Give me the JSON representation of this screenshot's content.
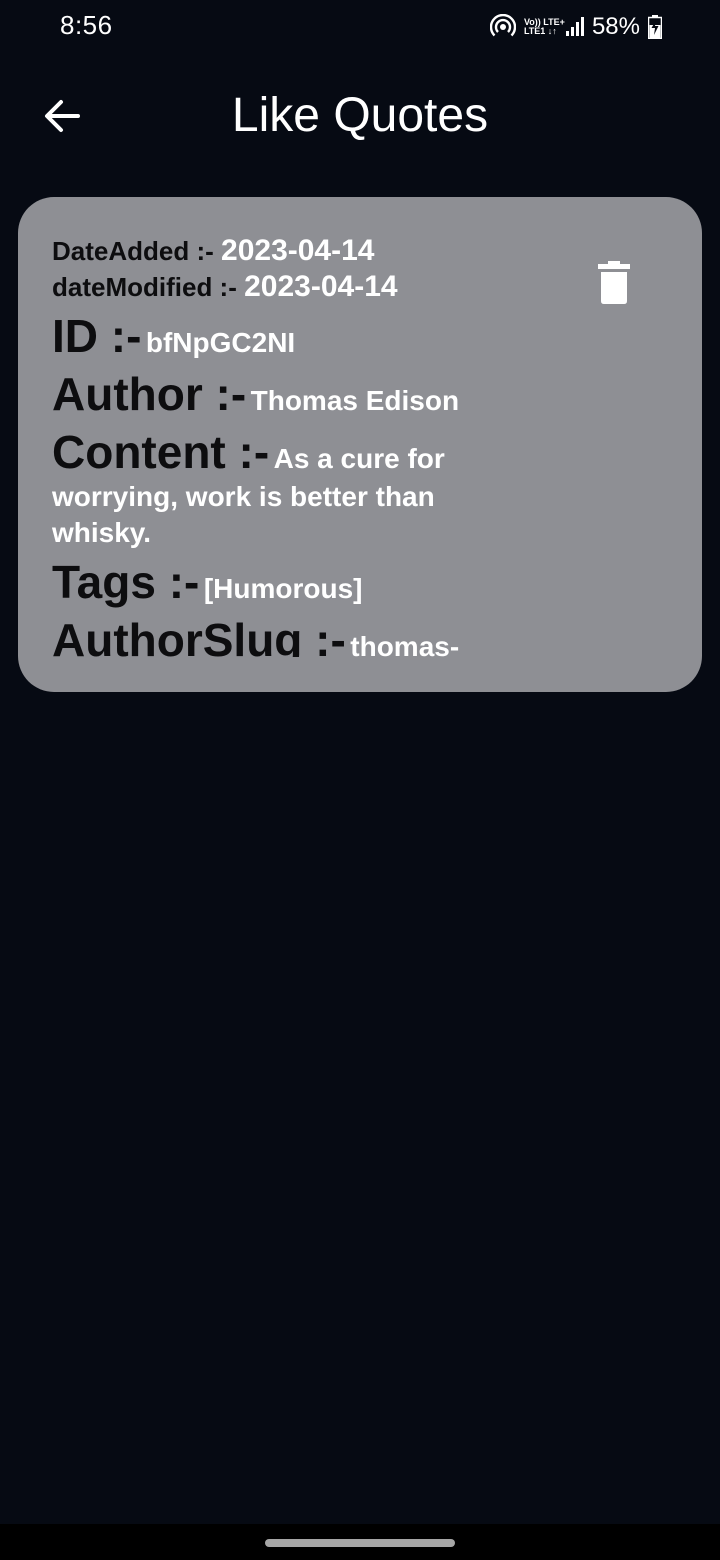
{
  "status_bar": {
    "time": "8:56",
    "network_line1": "Vo)) LTE+",
    "network_line2": "LTE1 ↓↑",
    "battery": "58%",
    "icons": [
      "hotspot-icon",
      "volte-icon",
      "signal-icon",
      "battery-charging-icon"
    ]
  },
  "app_bar": {
    "title": "Like Quotes",
    "back_icon": "arrow-left-icon"
  },
  "quote": {
    "date_added_label": "DateAdded :-",
    "date_added": "2023-04-14",
    "date_modified_label": "dateModified :-",
    "date_modified": "2023-04-14",
    "id_label": "ID :-",
    "id": "bfNpGC2NI",
    "author_label": "Author :-",
    "author": "Thomas Edison",
    "content_label": "Content :-",
    "content": "As a cure for worrying, work is better than whisky.",
    "tags_label": "Tags :-",
    "tags": "[Humorous]",
    "author_slug_label": "AuthorSlug :-",
    "author_slug": "thomas-",
    "delete_icon": "trash-icon"
  },
  "colors": {
    "background": "#060a13",
    "card": "#8e8f94",
    "label": "#0d0d0f",
    "value": "#ffffff"
  }
}
